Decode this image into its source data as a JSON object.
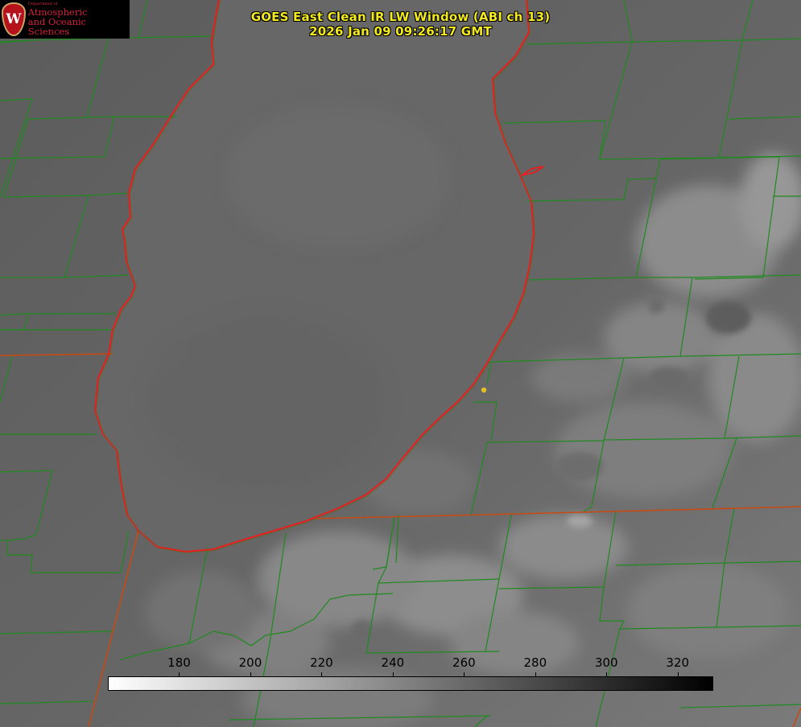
{
  "title": {
    "line1": "GOES East Clean IR LW Window (ABI ch 13)",
    "line2": "2026 Jan 09 09:26:17 GMT"
  },
  "logo": {
    "icon": "uw-crest-icon",
    "letter": "W",
    "dept": "Department of",
    "line1": "Atmospheric",
    "line2": "and Oceanic Sciences"
  },
  "colorbar": {
    "min": 160,
    "max": 330,
    "ticks": [
      180,
      200,
      220,
      240,
      260,
      280,
      300,
      320
    ],
    "start_color": "#ffffff",
    "end_color": "#000000"
  },
  "colors": {
    "lake_shoreline": "#e81e1e",
    "county_lines": "#1f8a1f",
    "state_lines": "#c84a12",
    "lake_fill": "#676767",
    "marker": "#e0c020"
  }
}
